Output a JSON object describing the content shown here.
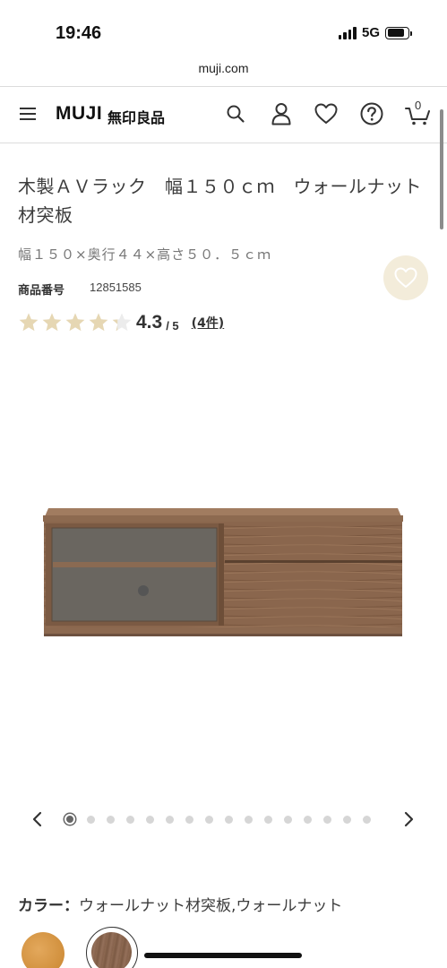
{
  "status_bar": {
    "time": "19:46",
    "network": "5G",
    "battery_level": 0.85
  },
  "browser": {
    "url": "muji.com"
  },
  "header": {
    "menu_icon": "hamburger-icon",
    "logo_text": "MUJI",
    "logo_jp": "無印良品",
    "icons": [
      "search-icon",
      "account-icon",
      "heart-icon",
      "help-icon",
      "cart-icon"
    ],
    "cart_count": "0"
  },
  "product": {
    "title": "木製ＡＶラック　幅１５０ｃｍ　ウォールナット材突板",
    "size": "幅１５０×奥行４４×高さ５０．５ｃｍ",
    "code_label": "商品番号",
    "code_value": "12851585",
    "rating_value": "4.3",
    "rating_max": "/ 5",
    "rating_count": "(4件)",
    "rating_stars": 4.3,
    "star_color": "#e6d7b3"
  },
  "carousel": {
    "total_images": 16,
    "current_index": 0
  },
  "color": {
    "label": "カラー：",
    "value": "ウォールナット材突板,ウォールナット",
    "swatches": [
      {
        "name": "oak",
        "color": "#d4954a"
      },
      {
        "name": "walnut",
        "color": "#85614b",
        "selected": true
      }
    ]
  }
}
